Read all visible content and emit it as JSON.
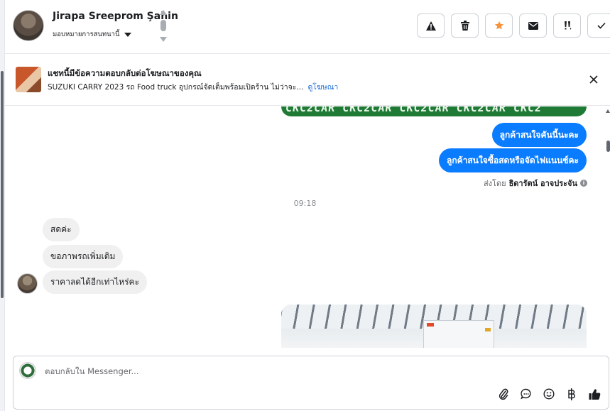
{
  "header": {
    "contact_name": "Jirapa Sreeprom Şahin",
    "assign_label": "มอบหมายการสนทนานี้",
    "actions": [
      {
        "name": "spam",
        "icon": "warning-icon"
      },
      {
        "name": "delete",
        "icon": "trash-icon"
      },
      {
        "name": "star",
        "icon": "star-icon"
      },
      {
        "name": "mark-unread",
        "icon": "envelope-icon"
      },
      {
        "name": "follow-up",
        "icon": "exclamation-icon"
      },
      {
        "name": "done",
        "icon": "check-icon"
      }
    ],
    "accent_star": "#f7923a"
  },
  "ad_banner": {
    "title": "แชทนี้มีข้อความตอบกลับต่อโฆษณาของคุณ",
    "ad_text": "SUZUKI CARRY 2023 รถ Food truck อุปกรณ์จัดเต็มพร้อมเปิดร้าน ไม่ว่าจะ...",
    "link_label": "ดูโฆษณา"
  },
  "chat": {
    "top_media_text": "CKC2CAR CKC2CAR CKC2CAR CKC2CAR CKC2",
    "outgoing": [
      "ลูกค้าสนใจคันนี้นะคะ",
      "ลูกค้าสนใจซื้อสดหรือจัดไฟแนนซ์คะ"
    ],
    "sent_by_prefix": "ส่งโดย",
    "sent_by_name": "ธิดารัตน์ อาจประจัน",
    "timestamp": "09:18",
    "incoming": [
      "สดค่ะ",
      "ขอภาพรถเพิ่มเติม",
      "ราคาลดได้อีกเท่าไหร่คะ"
    ],
    "outgoing_color": "#0a7cff"
  },
  "composer": {
    "placeholder": "ตอบกลับใน Messenger...",
    "tools": [
      "attachment-icon",
      "quick-reply-icon",
      "emoji-icon",
      "baht-icon",
      "thumbs-up-icon"
    ]
  }
}
